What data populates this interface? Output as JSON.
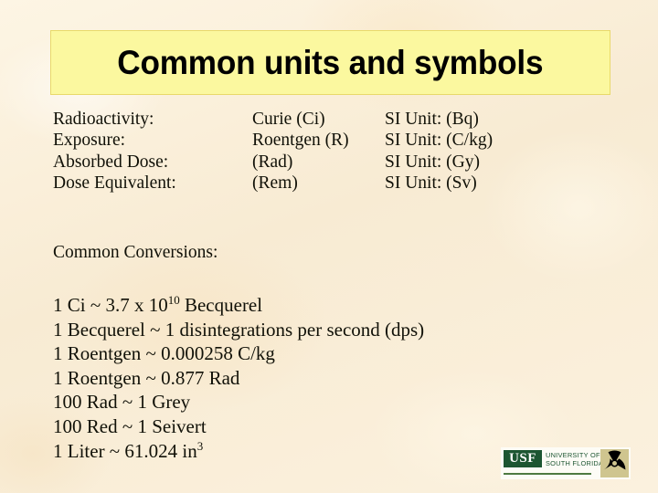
{
  "slide": {
    "title": "Common units and symbols",
    "background_color": "#fbf0d9",
    "title_box_color": "#fbf89f",
    "title_box_border_color": "#e8d96a",
    "text_color": "#111108"
  },
  "units_table": {
    "rows": [
      {
        "quantity": "Radioactivity:",
        "unit": "Curie (Ci)",
        "si_label": "SI Unit: (Bq)"
      },
      {
        "quantity": "Exposure:",
        "unit": "Roentgen (R)",
        "si_label": "SI Unit: (C/kg)"
      },
      {
        "quantity": "Absorbed Dose:",
        "unit": "(Rad)",
        "si_label": "SI Unit: (Gy)"
      },
      {
        "quantity": "Dose Equivalent:",
        "unit": "(Rem)",
        "si_label": "SI Unit: (Sv)"
      }
    ]
  },
  "conversions": {
    "heading": "Common Conversions:",
    "items": [
      {
        "prefix": "1 Ci ~ 3.7 x 10",
        "sup": "10",
        "suffix": " Becquerel"
      },
      {
        "prefix": "1 Becquerel ~ 1 disintegrations per second (dps)",
        "sup": "",
        "suffix": ""
      },
      {
        "prefix": "1 Roentgen ~ 0.000258 C/kg",
        "sup": "",
        "suffix": ""
      },
      {
        "prefix": "1 Roentgen ~ 0.877 Rad",
        "sup": "",
        "suffix": ""
      },
      {
        "prefix": "100 Rad ~ 1 Grey",
        "sup": "",
        "suffix": ""
      },
      {
        "prefix": "100 Red ~ 1 Seivert",
        "sup": "",
        "suffix": ""
      },
      {
        "prefix": "1 Liter ~ 61.024 in",
        "sup": "3",
        "suffix": ""
      }
    ]
  },
  "logo": {
    "badge": "USF",
    "wordmark_line1": "UNIVERSITY OF",
    "wordmark_line2": "SOUTH FLORIDA.",
    "green": "#1d5632",
    "radiation_disc_color": "#cfc58f",
    "radiation_blade_color": "#000000"
  }
}
